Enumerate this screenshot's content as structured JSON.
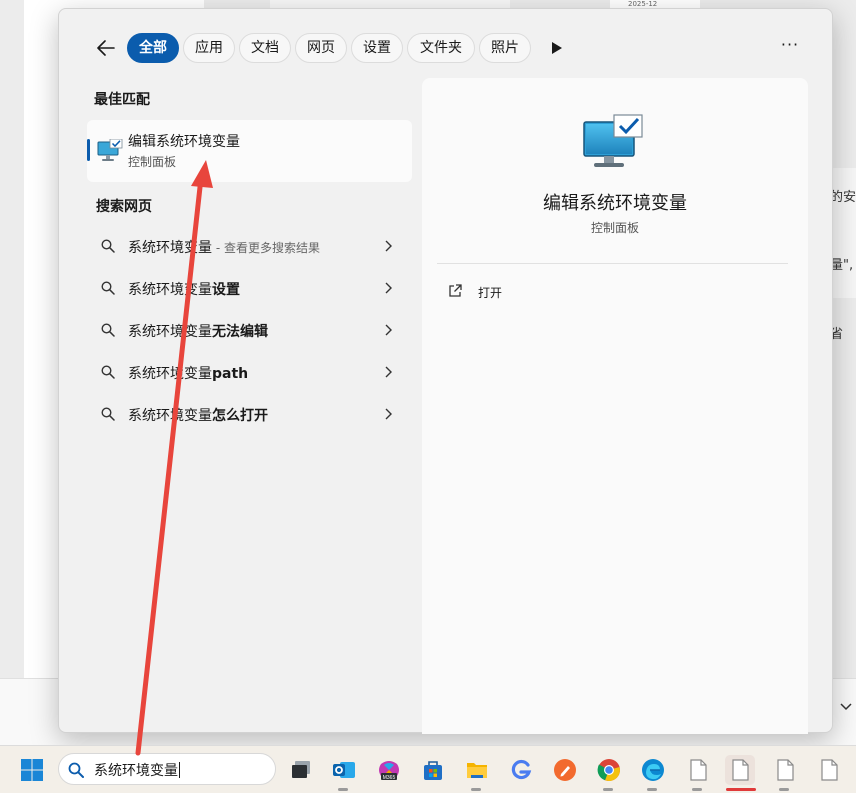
{
  "background": {
    "tiny_label": "2025-12",
    "side_texts": [
      "的安",
      "量\",",
      "省"
    ]
  },
  "filters": {
    "tabs": [
      {
        "label": "全部",
        "active": true
      },
      {
        "label": "应用"
      },
      {
        "label": "文档"
      },
      {
        "label": "网页"
      },
      {
        "label": "设置"
      },
      {
        "label": "文件夹"
      },
      {
        "label": "照片"
      }
    ],
    "more_label": "···"
  },
  "best_match": {
    "section_title": "最佳匹配",
    "name": "编辑系统环境变量",
    "subtitle": "控制面板",
    "icon": "monitor-check-icon"
  },
  "web_search": {
    "section_title": "搜索网页",
    "items": [
      {
        "prefix": "系统环境变量",
        "bold": "",
        "hint": " - 查看更多搜索结果"
      },
      {
        "prefix": "系统环境变量",
        "bold": "设置",
        "hint": ""
      },
      {
        "prefix": "系统环境变量",
        "bold": "无法编辑",
        "hint": ""
      },
      {
        "prefix": "系统环境变量",
        "bold": "path",
        "hint": ""
      },
      {
        "prefix": "系统环境变量",
        "bold": "怎么打开",
        "hint": ""
      }
    ]
  },
  "preview": {
    "title": "编辑系统环境变量",
    "subtitle": "控制面板",
    "actions": [
      {
        "label": "打开",
        "icon": "open-external-icon"
      }
    ]
  },
  "taskbar": {
    "search_value": "系统环境变量",
    "apps": [
      {
        "name": "task-view",
        "icon": "task-view-icon"
      },
      {
        "name": "outlook",
        "icon": "outlook-icon"
      },
      {
        "name": "m365",
        "icon": "m365-copilot-icon"
      },
      {
        "name": "store",
        "icon": "store-icon"
      },
      {
        "name": "file-explorer",
        "icon": "folder-icon"
      },
      {
        "name": "g-app",
        "icon": "g-app-icon"
      },
      {
        "name": "orange-app",
        "icon": "pen-app-icon"
      },
      {
        "name": "chrome",
        "icon": "chrome-icon"
      },
      {
        "name": "edge",
        "icon": "edge-icon"
      },
      {
        "name": "document-1",
        "icon": "document-icon"
      },
      {
        "name": "document-2",
        "icon": "document-icon"
      },
      {
        "name": "document-3",
        "icon": "document-icon"
      },
      {
        "name": "document-4",
        "icon": "document-icon"
      }
    ]
  },
  "colors": {
    "accent": "#0b5cad",
    "annotation_arrow": "#e8453c"
  }
}
